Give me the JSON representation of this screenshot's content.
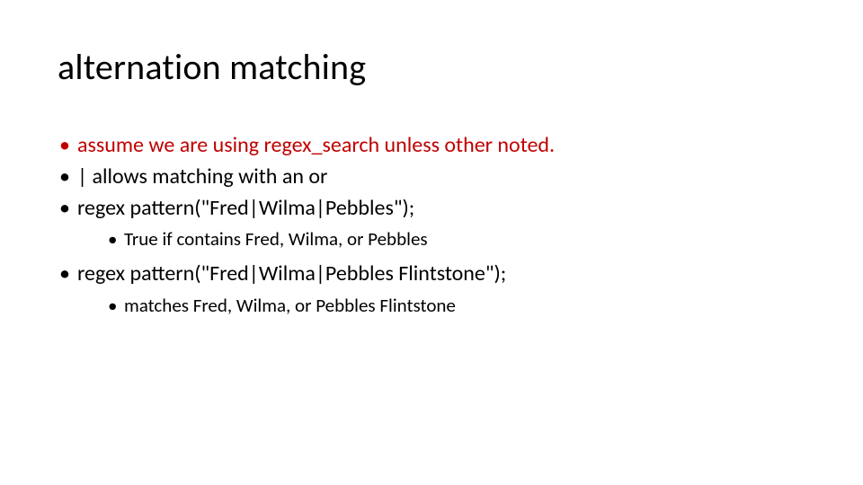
{
  "title": "alternation matching",
  "bullets": {
    "b1": {
      "text": "assume we are using regex_search unless other noted.",
      "red": true
    },
    "b2": {
      "text": "| allows matching with an or",
      "red": false
    },
    "b3": {
      "text": "regex pattern(\"Fred|Wilma|Pebbles\");",
      "red": false,
      "sub": {
        "s1": "True if contains Fred, Wilma, or Pebbles"
      }
    },
    "b4": {
      "text": "regex pattern(\"Fred|Wilma|Pebbles Flintstone\");",
      "red": false,
      "sub": {
        "s1": "matches Fred, Wilma, or Pebbles Flintstone"
      }
    }
  }
}
